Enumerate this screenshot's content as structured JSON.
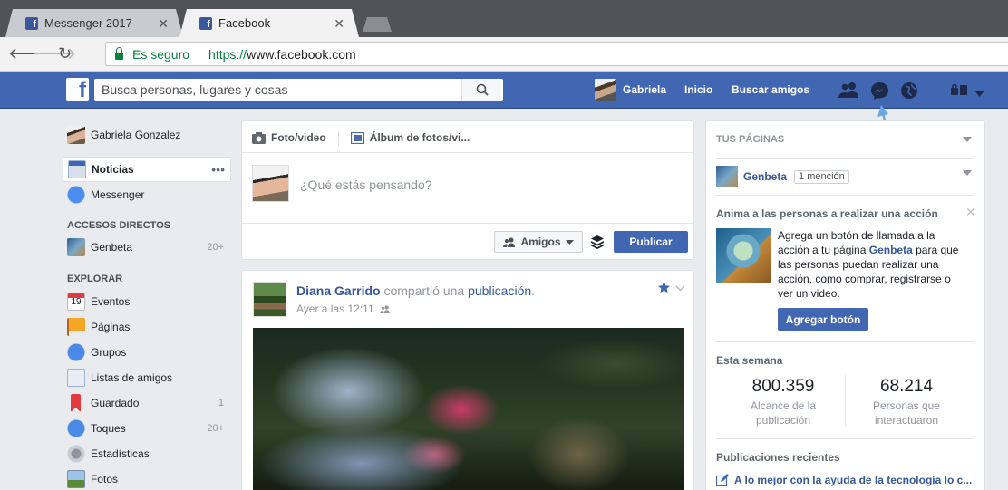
{
  "browser": {
    "tabs": [
      {
        "title": "Messenger 2017",
        "active": false
      },
      {
        "title": "Facebook",
        "active": true
      }
    ],
    "security_label": "Es seguro",
    "url_protocol": "https://",
    "url_host": "www.facebook.com"
  },
  "fb_header": {
    "search_placeholder": "Busca personas, lugares y cosas",
    "user_name": "Gabriela",
    "home_label": "Inicio",
    "find_friends_label": "Buscar amigos"
  },
  "sidebar": {
    "profile_name": "Gabriela Gonzalez",
    "main_items": [
      {
        "label": "Noticias"
      },
      {
        "label": "Messenger"
      }
    ],
    "shortcuts_header": "ACCESOS DIRECTOS",
    "shortcuts": [
      {
        "label": "Genbeta",
        "count": "20+"
      }
    ],
    "explore_header": "EXPLORAR",
    "explore_items": [
      {
        "label": "Eventos",
        "count": "",
        "icon_text": "19"
      },
      {
        "label": "Páginas",
        "count": ""
      },
      {
        "label": "Grupos",
        "count": ""
      },
      {
        "label": "Listas de amigos",
        "count": ""
      },
      {
        "label": "Guardado",
        "count": "1"
      },
      {
        "label": "Toques",
        "count": "20+"
      },
      {
        "label": "Estadísticas",
        "count": ""
      },
      {
        "label": "Fotos",
        "count": ""
      }
    ],
    "more_dots": "•••"
  },
  "composer": {
    "tab_photo": "Foto/video",
    "tab_album": "Álbum de fotos/vi...",
    "prompt": "¿Qué estás pensando?",
    "audience_label": "Amigos",
    "publish_label": "Publicar"
  },
  "post": {
    "author": "Diana Garrido",
    "action_text": "compartió una",
    "object_link": "publicación",
    "trailing": ".",
    "timestamp": "Ayer a las 12:11"
  },
  "right": {
    "pages_header": "TUS PÁGINAS",
    "page_name": "Genbeta",
    "mention_badge": "1 mención",
    "cta_title": "Anima a las personas a realizar una acción",
    "cta_text_before": "Agrega un botón de llamada a la acción a tu página ",
    "cta_text_page": "Genbeta",
    "cta_text_after": " para que las personas puedan realizar una acción, como comprar, registrarse o ver un video.",
    "cta_button": "Agregar botón",
    "week_title": "Esta semana",
    "stat1_value": "800.359",
    "stat1_label": "Alcance de la publicación",
    "stat2_value": "68.214",
    "stat2_label": "Personas que interactuaron",
    "recent_title": "Publicaciones recientes",
    "recent_item": "A lo mejor con la ayuda de la tecnología lo c..."
  },
  "colors": {
    "facebook_blue": "#4267b2",
    "link_blue": "#365899",
    "secure_green": "#0b8043",
    "page_background": "#e9ebee"
  },
  "icons": [
    "facebook-logo-icon",
    "search-icon",
    "friend-requests-icon",
    "messenger-icon",
    "notifications-globe-icon",
    "quick-help-icon",
    "chevron-down-icon",
    "camera-icon",
    "album-icon",
    "audience-friends-icon",
    "layers-icon",
    "star-icon",
    "lock-icon",
    "back-icon",
    "forward-icon",
    "reload-icon",
    "edit-icon"
  ]
}
